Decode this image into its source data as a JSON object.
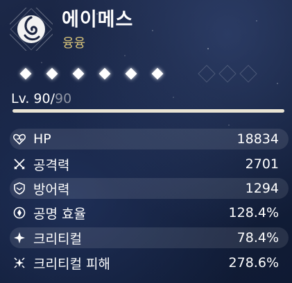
{
  "character": {
    "name": "에이메스",
    "element": "융융"
  },
  "constellations": {
    "unlocked": 6,
    "total": 6
  },
  "level": {
    "prefix": "Lv. 90/",
    "max": "90",
    "progress": 1.0
  },
  "stats": [
    {
      "icon": "heart-icon",
      "label": "HP",
      "value": "18834"
    },
    {
      "icon": "crossed-swords-icon",
      "label": "공격력",
      "value": "2701"
    },
    {
      "icon": "shield-icon",
      "label": "방어력",
      "value": "1294"
    },
    {
      "icon": "energy-recharge-icon",
      "label": "공명 효율",
      "value": "128.4%"
    },
    {
      "icon": "crit-star-icon",
      "label": "크리티컬",
      "value": "78.4%"
    },
    {
      "icon": "crit-burst-icon",
      "label": "크리티컬 피해",
      "value": "278.6%"
    }
  ],
  "colors": {
    "element_text": "#d7c37a",
    "level_max_text": "#8f95a3",
    "background": "#14203c"
  }
}
